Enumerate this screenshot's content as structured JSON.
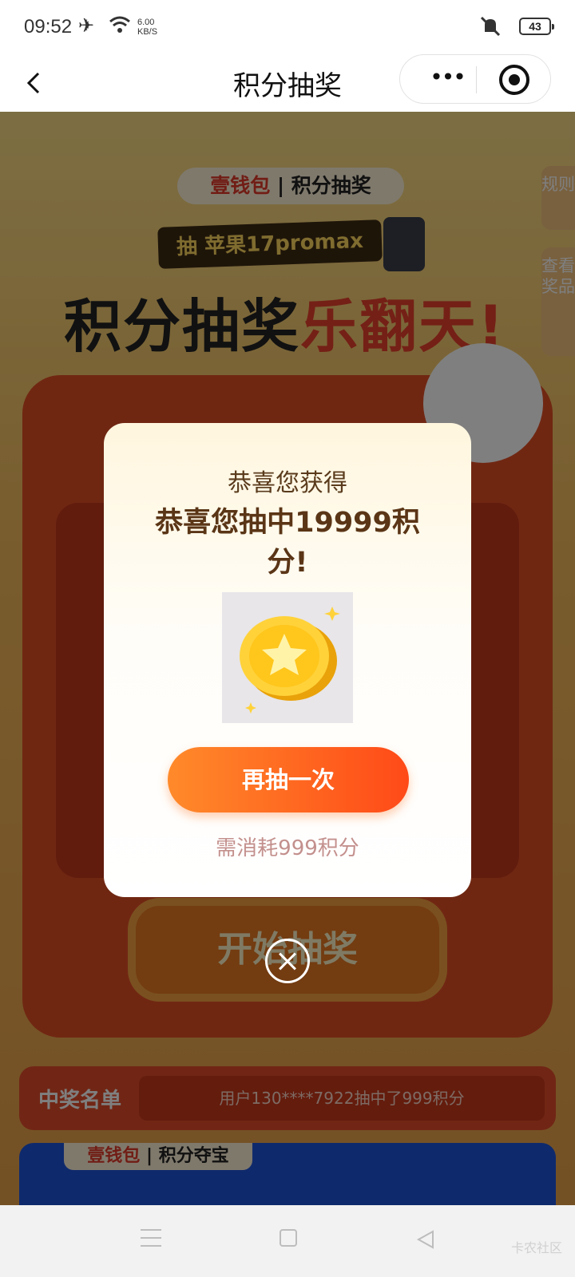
{
  "status_bar": {
    "time": "09:52",
    "net_speed_value": "6.00",
    "net_speed_unit": "KB/S",
    "battery": "43",
    "icons": [
      "airplane-icon",
      "wifi-icon",
      "mute-icon",
      "battery-icon"
    ]
  },
  "nav": {
    "title": "积分抽奖",
    "more_label": "•••",
    "icons": [
      "back-icon",
      "more-icon",
      "target-icon"
    ]
  },
  "background": {
    "brand_a": "壹钱包",
    "brand_b": "积分抽奖",
    "promo": "抽 苹果17promax",
    "headline_a": "积分抽奖",
    "headline_b": "乐翻天!",
    "side_rules": "规则",
    "side_prizes": "查看奖品",
    "start_button": "开始抽奖",
    "winners_title": "中奖名单",
    "winners_text": "用户130****7922抽中了999积分",
    "banner_a": "壹钱包",
    "banner_b": "积分夺宝"
  },
  "dialog": {
    "subtitle": "恭喜您获得",
    "main": "恭喜您抽中19999积分!",
    "prize_icon": "gold-coin-star-icon",
    "again_button": "再抽一次",
    "cost_text": "需消耗999积分",
    "close_icon": "close-icon"
  },
  "system_nav": {
    "watermark": "卡农社区",
    "icons": [
      "menu-icon",
      "home-icon",
      "back-triangle-icon"
    ]
  },
  "colors": {
    "accent_orange": "#ff6a20",
    "title_brown": "#5a3516",
    "cost_pink": "#c3908d"
  }
}
